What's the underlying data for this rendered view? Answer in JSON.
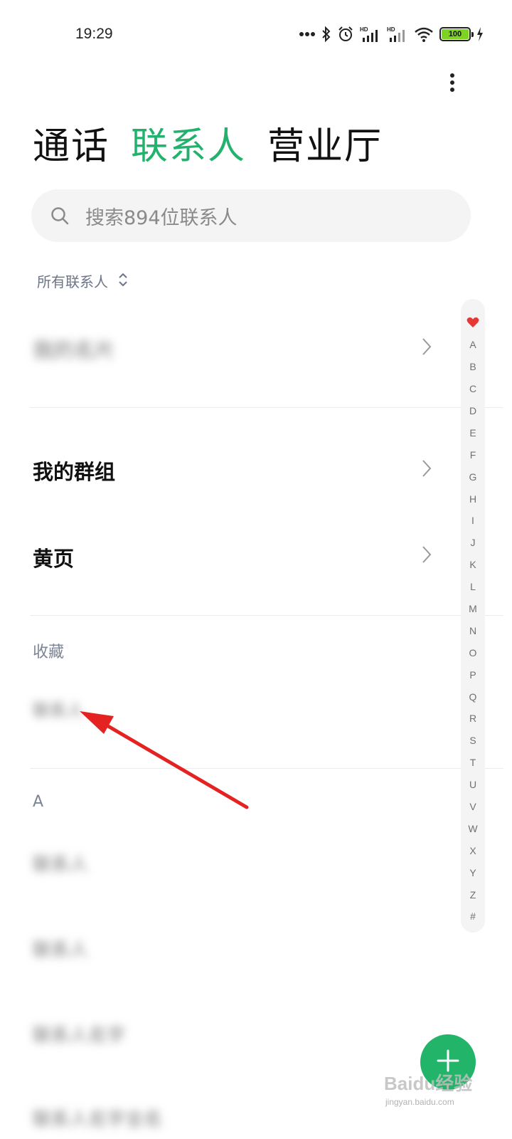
{
  "status_bar": {
    "time": "19:29",
    "battery": "100"
  },
  "tabs": [
    {
      "label": "通话"
    },
    {
      "label": "联系人"
    },
    {
      "label": "营业厅"
    }
  ],
  "search": {
    "placeholder": "搜索894位联系人"
  },
  "filter": {
    "label": "所有联系人"
  },
  "rows": {
    "my_profile": "我的名片",
    "my_groups": "我的群组",
    "yellow_pages": "黄页"
  },
  "sections": {
    "favorites": {
      "header": "收藏",
      "items": [
        "联系人"
      ]
    },
    "a": {
      "header": "A",
      "items": [
        "联系人",
        "联系人",
        "联系人名字",
        "联系人名字全名"
      ]
    }
  },
  "index_bar": {
    "letters": [
      "A",
      "B",
      "C",
      "D",
      "E",
      "F",
      "G",
      "H",
      "I",
      "J",
      "K",
      "L",
      "M",
      "N",
      "O",
      "P",
      "Q",
      "R",
      "S",
      "T",
      "U",
      "V",
      "W",
      "X",
      "Y",
      "Z",
      "#"
    ]
  },
  "watermark": {
    "text": "Baidu经验",
    "sub": "jingyan.baidu.com"
  },
  "colors": {
    "accent": "#23b26d",
    "fab": "#22b468",
    "heart": "#e53935",
    "arrow": "#e52222"
  }
}
